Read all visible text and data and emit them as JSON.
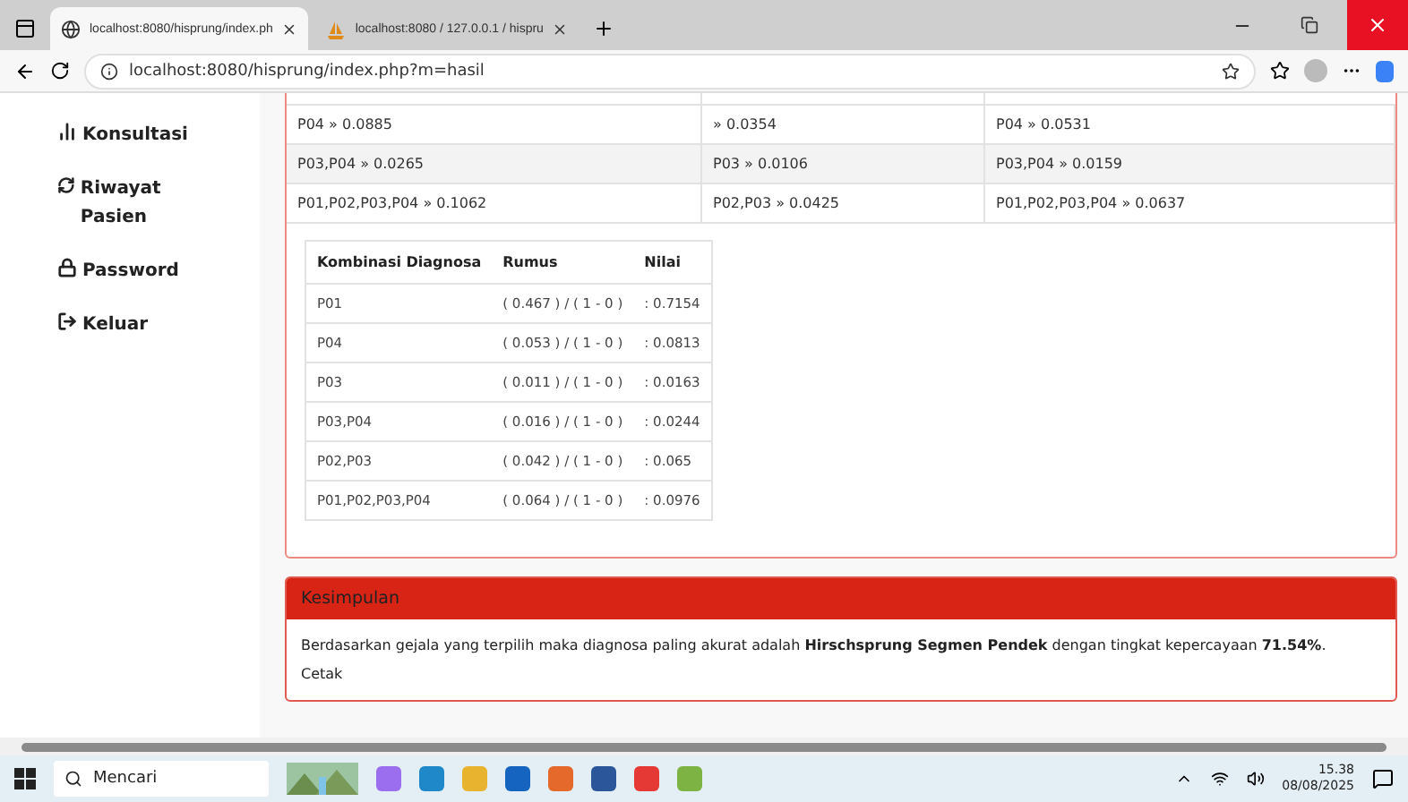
{
  "browser": {
    "tabs": [
      {
        "title": "localhost:8080/hisprung/index.ph",
        "kind": "globe",
        "selected": true
      },
      {
        "title": "localhost:8080 / 127.0.0.1 / hispru",
        "kind": "pma",
        "selected": false
      }
    ],
    "url": "localhost:8080/hisprung/index.php?m=hasil"
  },
  "sidebar": {
    "items": [
      {
        "label": "Konsultasi",
        "kind": "chart"
      },
      {
        "label": "Riwayat Pasien",
        "kind": "refresh"
      },
      {
        "label": "Password",
        "kind": "lock"
      },
      {
        "label": "Keluar",
        "kind": "exit"
      }
    ]
  },
  "combination_table": {
    "rows": [
      [
        "P04 » 0.0885",
        "» 0.0354",
        "P04 » 0.0531"
      ],
      [
        "P03,P04 » 0.0265",
        "P03 » 0.0106",
        "P03,P04 » 0.0159"
      ],
      [
        "P01,P02,P03,P04 » 0.1062",
        "P02,P03 » 0.0425",
        "P01,P02,P03,P04 » 0.0637"
      ]
    ]
  },
  "result_table": {
    "columns": [
      "Kombinasi Diagnosa",
      "Rumus",
      "Nilai"
    ],
    "rows": [
      [
        "P01",
        "( 0.467 ) / ( 1 - 0 )",
        ": 0.7154"
      ],
      [
        "P04",
        "( 0.053 ) / ( 1 - 0 )",
        ": 0.0813"
      ],
      [
        "P03",
        "( 0.011 ) / ( 1 - 0 )",
        ": 0.0163"
      ],
      [
        "P03,P04",
        "( 0.016 ) / ( 1 - 0 )",
        ": 0.0244"
      ],
      [
        "P02,P03",
        "( 0.042 ) / ( 1 - 0 )",
        ": 0.065"
      ],
      [
        "P01,P02,P03,P04",
        "( 0.064 ) / ( 1 - 0 )",
        ": 0.0976"
      ]
    ]
  },
  "conclusion": {
    "title": "Kesimpulan",
    "text": "Berdasarkan gejala yang terpilih maka diagnosa paling akurat adalah **Hirschsprung Segmen Pendek** dengan tingkat kepercayaan **71.54%**.",
    "print_link": "Cetak"
  },
  "taskbar": {
    "search_placeholder": "Mencari",
    "time": "15.38",
    "date": "08/08/2025"
  }
}
